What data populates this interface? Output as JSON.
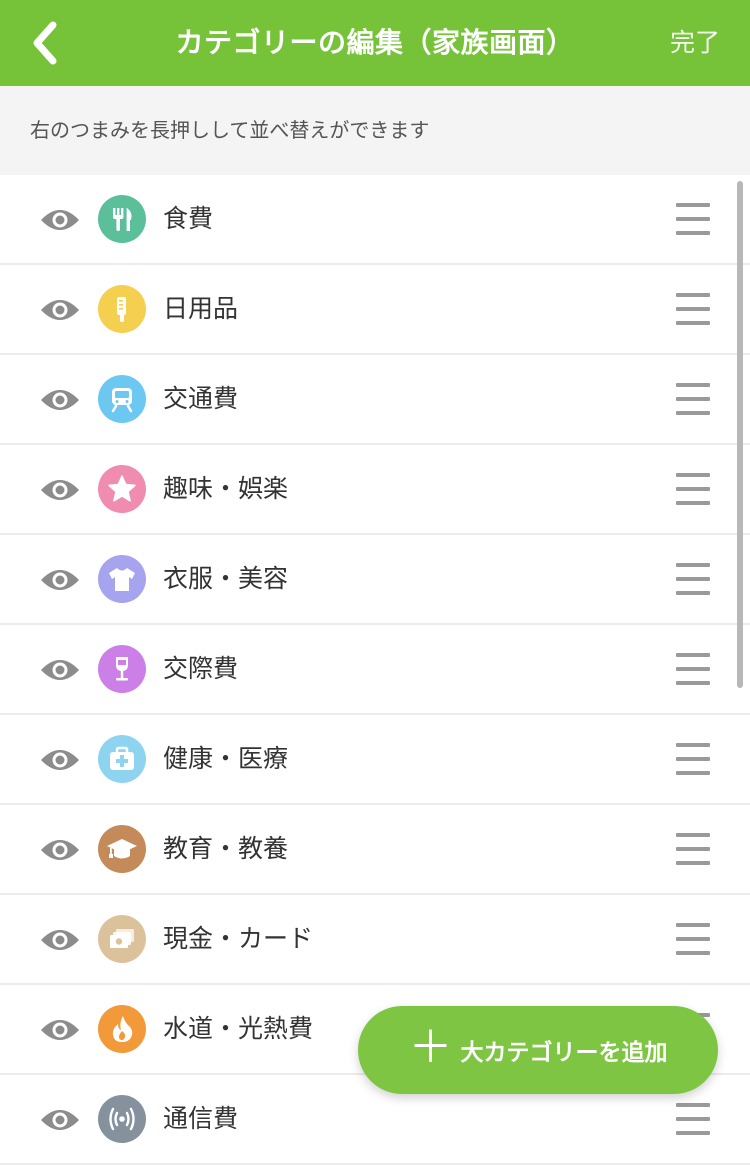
{
  "header": {
    "title": "カテゴリーの編集（家族画面）",
    "done_label": "完了",
    "back_icon": "chevron-left-icon",
    "bg_color": "#76c33a"
  },
  "hint": "右のつまみを長押しして並べ替えができます",
  "categories": [
    {
      "label": "食費",
      "icon": "fork-knife-icon",
      "color": "#5bbf9a"
    },
    {
      "label": "日用品",
      "icon": "toothbrush-icon",
      "color": "#f5cf4f"
    },
    {
      "label": "交通費",
      "icon": "train-icon",
      "color": "#6cc8f0"
    },
    {
      "label": "趣味・娯楽",
      "icon": "star-icon",
      "color": "#ef8cb0"
    },
    {
      "label": "衣服・美容",
      "icon": "tshirt-icon",
      "color": "#a6a3ef"
    },
    {
      "label": "交際費",
      "icon": "wine-glass-icon",
      "color": "#cd7fe8"
    },
    {
      "label": "健康・医療",
      "icon": "medical-kit-icon",
      "color": "#8ed4f0"
    },
    {
      "label": "教育・教養",
      "icon": "graduation-cap-icon",
      "color": "#c58a5a"
    },
    {
      "label": "現金・カード",
      "icon": "cash-icon",
      "color": "#dcc29a"
    },
    {
      "label": "水道・光熱費",
      "icon": "flame-icon",
      "color": "#f29a3a"
    },
    {
      "label": "通信費",
      "icon": "signal-icon",
      "color": "#85929e"
    }
  ],
  "fab": {
    "label": "大カテゴリーを追加",
    "icon": "plus-icon",
    "color": "#7ec543"
  }
}
